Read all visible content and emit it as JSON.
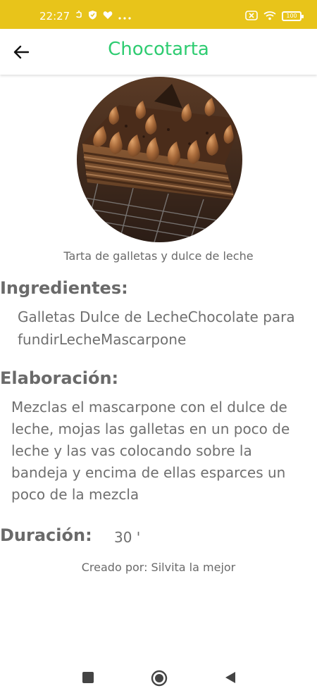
{
  "status": {
    "time": "22:27",
    "battery": "100"
  },
  "header": {
    "title": "Chocotarta",
    "title_color": "#2ecc71",
    "back_icon": "arrow-left-icon"
  },
  "recipe": {
    "description": "Tarta de galletas y dulce de leche",
    "ingredients_label": "Ingredientes:",
    "ingredients": "Galletas Dulce de LecheChocolate para fundirLecheMascarpone",
    "elaboration_label": "Elaboración:",
    "elaboration": "Mezclas el mascarpone con el dulce de leche, mojas las galletas en un poco de leche y las vas colocando sobre la bandeja y encima de ellas esparces un poco de la mezcla",
    "duration_label": "Duración:",
    "duration": "30 '",
    "author": "Creado por: Silvita la mejor"
  },
  "colors": {
    "status_bar": "#e8c41a",
    "accent": "#2ecc71"
  },
  "nav": {
    "recents_icon": "square-icon",
    "home_icon": "circle-home-icon",
    "back_icon": "triangle-back-icon"
  }
}
